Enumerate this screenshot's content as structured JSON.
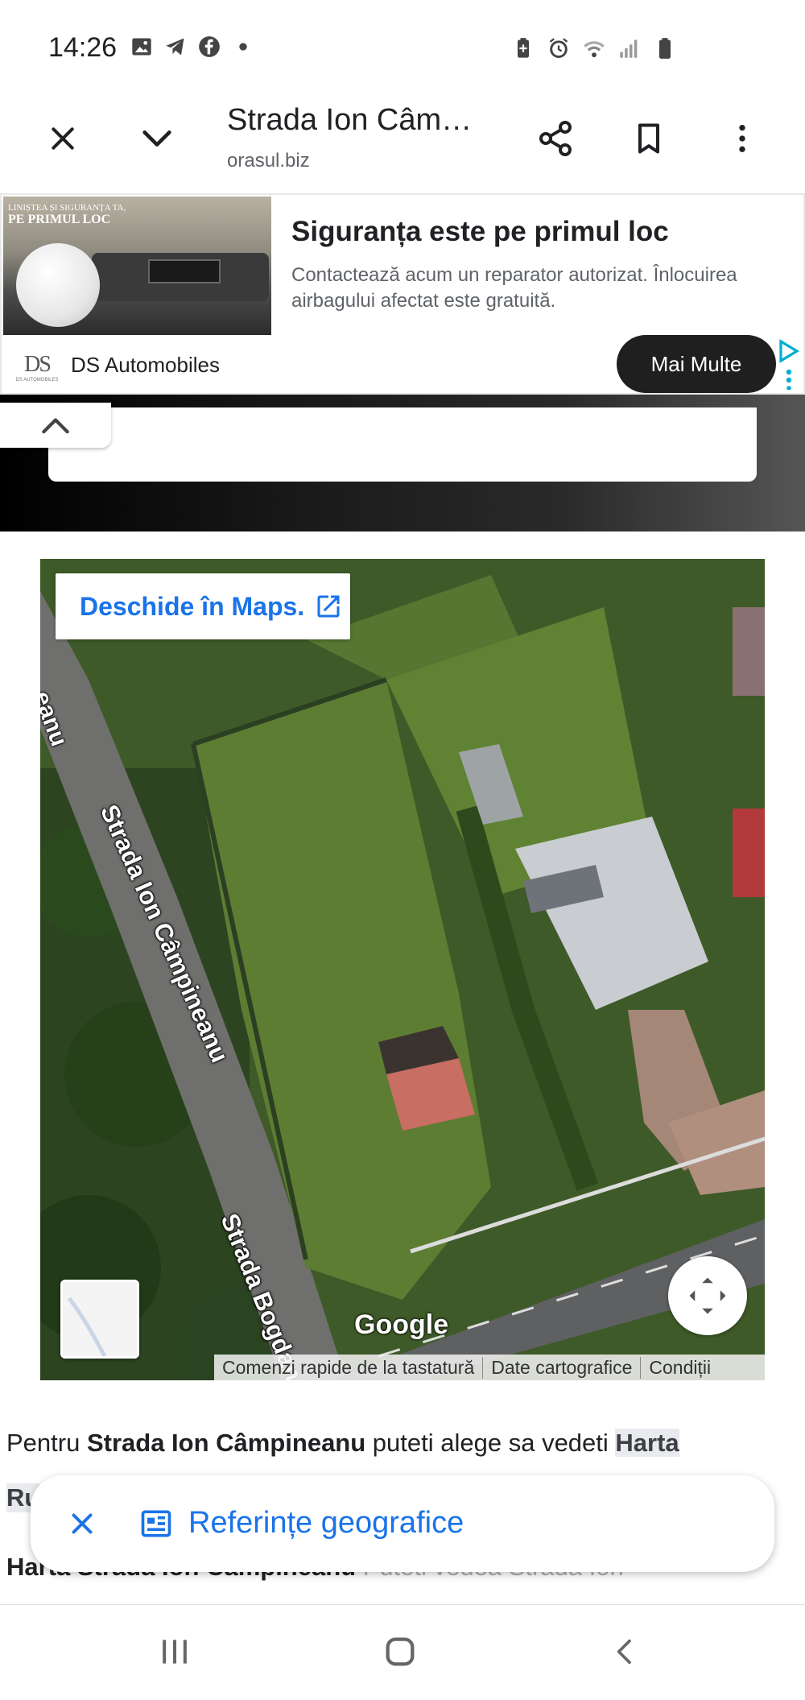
{
  "status_bar": {
    "time": "14:26",
    "left_icons": [
      "gallery-icon",
      "telegram-icon",
      "facebook-icon",
      "dot-icon"
    ],
    "right_icons": [
      "battery-saver-icon",
      "alarm-icon",
      "wifi-icon",
      "signal-icon",
      "battery-icon"
    ]
  },
  "toolbar": {
    "title": "Strada Ion Câm…",
    "domain": "orasul.biz",
    "icons": [
      "close-icon",
      "chevron-down-icon",
      "share-icon",
      "bookmark-icon",
      "more-vert-icon"
    ]
  },
  "ad": {
    "image_caption_small": "LINIȘTEA ȘI SIGURANȚA TA,",
    "image_caption_big": "PE PRIMUL LOC",
    "title": "Siguranța este pe primul loc",
    "description": "Contactează acum un reparator autorizat. Înlocuirea airbagului afectat este gratuită.",
    "logo_mark": "DS",
    "logo_small": "DS AUTOMOBILES",
    "brand": "DS Automobiles",
    "cta": "Mai Multe"
  },
  "map": {
    "open_in_maps": "Deschide în Maps.",
    "street_label_1": "Strada Ion Câmpineanu",
    "street_label_1_partial": "eanu",
    "street_label_2": "Strada Bogdan Voievod",
    "google_logo": "Google",
    "footer": {
      "shortcuts": "Comenzi rapide de la tastatură",
      "map_data": "Date cartografice",
      "terms": "Condiții"
    }
  },
  "content": {
    "para_before": "Pentru ",
    "para_street": "Strada Ion Câmpineanu",
    "para_middle": " puteti alege sa vedeti ",
    "para_link": "Harta",
    "line2_fragment": "Ru",
    "line3_start": "Harta Strada Ion Câmpineanu",
    "line3_faded": " Puteti vedea Strada Ion"
  },
  "geo_chip": {
    "label": "Referințe geografice"
  },
  "nav_bar": {
    "icons": [
      "recents-icon",
      "home-icon",
      "back-icon"
    ]
  }
}
